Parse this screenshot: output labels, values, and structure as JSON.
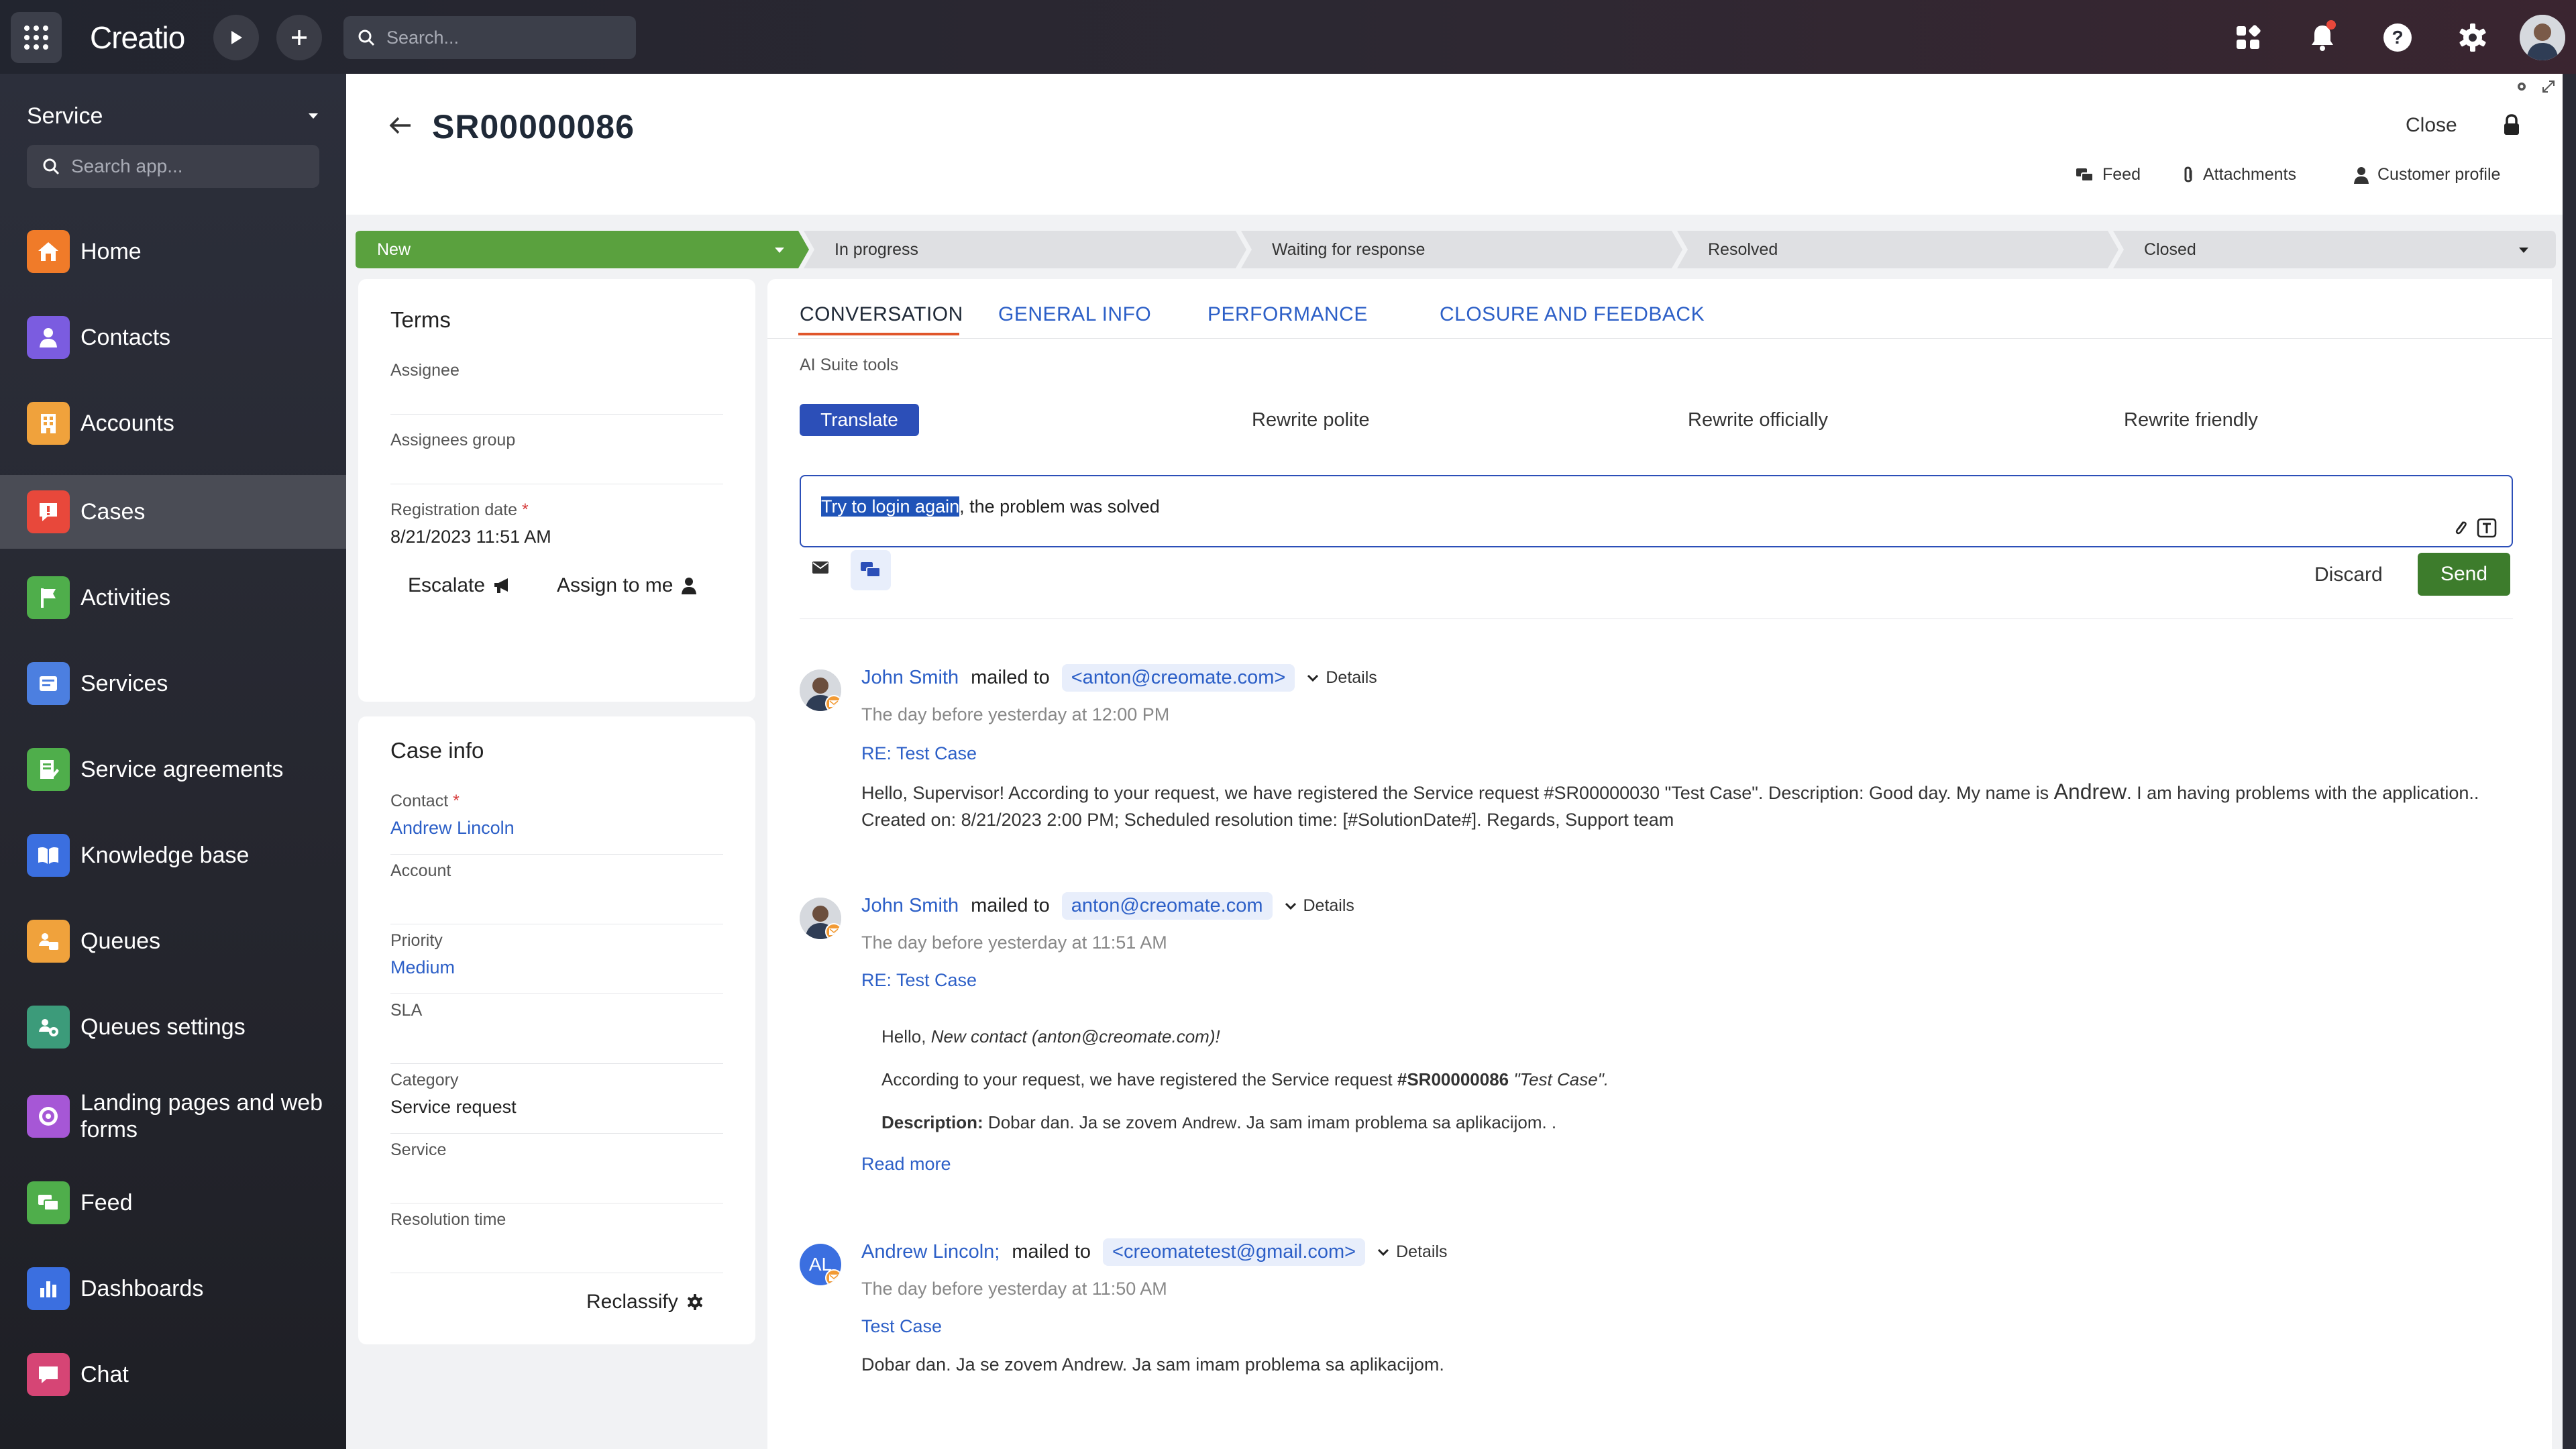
{
  "topbar": {
    "logo": "Creatio",
    "search_placeholder": "Search..."
  },
  "sidebar": {
    "workplace": "Service",
    "search_placeholder": "Search app...",
    "items": [
      {
        "label": "Home",
        "icon": "home-icon",
        "color": "#f07b29"
      },
      {
        "label": "Contacts",
        "icon": "contacts-icon",
        "color": "#7b5ce0"
      },
      {
        "label": "Accounts",
        "icon": "accounts-icon",
        "color": "#f0a23c"
      },
      {
        "label": "Cases",
        "icon": "cases-icon",
        "color": "#e8483b"
      },
      {
        "label": "Activities",
        "icon": "activities-icon",
        "color": "#4fae4b"
      },
      {
        "label": "Services",
        "icon": "services-icon",
        "color": "#4c7fe0"
      },
      {
        "label": "Service agreements",
        "icon": "service-agreements-icon",
        "color": "#4fae4b"
      },
      {
        "label": "Knowledge base",
        "icon": "knowledge-base-icon",
        "color": "#3b6fe0"
      },
      {
        "label": "Queues",
        "icon": "queues-icon",
        "color": "#f0a23c"
      },
      {
        "label": "Queues settings",
        "icon": "queues-settings-icon",
        "color": "#3c9b7a"
      },
      {
        "label": "Landing pages and web forms",
        "icon": "landing-pages-icon",
        "color": "#a657d6"
      },
      {
        "label": "Feed",
        "icon": "feed-icon",
        "color": "#4fae4b"
      },
      {
        "label": "Dashboards",
        "icon": "dashboards-icon",
        "color": "#3b6fe0"
      },
      {
        "label": "Chat",
        "icon": "chat-icon",
        "color": "#d64575"
      }
    ]
  },
  "record": {
    "title": "SR00000086",
    "close_label": "Close",
    "links": [
      "Feed",
      "Attachments",
      "Customer profile"
    ]
  },
  "stages": [
    "New",
    "In progress",
    "Waiting for response",
    "Resolved",
    "Closed"
  ],
  "terms": {
    "title": "Terms",
    "assignee_label": "Assignee",
    "assignees_group_label": "Assignees group",
    "registration_date_label": "Registration date",
    "registration_date": "8/21/2023 11:51 AM",
    "escalate": "Escalate",
    "assign_to_me": "Assign to me"
  },
  "case_info": {
    "title": "Case info",
    "contact_label": "Contact",
    "contact": "Andrew Lincoln",
    "account_label": "Account",
    "priority_label": "Priority",
    "priority": "Medium",
    "sla_label": "SLA",
    "category_label": "Category",
    "category": "Service request",
    "service_label": "Service",
    "resolution_time_label": "Resolution time",
    "reclassify": "Reclassify"
  },
  "tabs": [
    "CONVERSATION",
    "GENERAL INFO",
    "PERFORMANCE",
    "CLOSURE AND FEEDBACK"
  ],
  "ai": {
    "label": "AI Suite tools",
    "translate": "Translate",
    "rewrite_polite": "Rewrite polite",
    "rewrite_officially": "Rewrite officially",
    "rewrite_friendly": "Rewrite friendly"
  },
  "compose": {
    "highlighted": "Try to login again",
    "rest": ", the problem was solved",
    "discard": "Discard",
    "send": "Send"
  },
  "messages": [
    {
      "from": "John Smith",
      "mailed_to": "mailed to",
      "to": "<anton@creomate.com>",
      "details": "Details",
      "time": "The day before yesterday at 12:00 PM",
      "subject": "RE: Test Case",
      "body_1": "Hello, Supervisor! According to your request, we have registered the Service request #SR00000030 \"Test Case\". Description: Good day. My name is ",
      "body_name": "Andrew",
      "body_2": ". I am having problems with the application.. Created on: 8/21/2023 2:00 PM; Scheduled resolution time: [#SolutionDate#]. Regards, Support team"
    },
    {
      "from": "John Smith",
      "mailed_to": "mailed to",
      "to": "anton@creomate.com",
      "details": "Details",
      "time": "The day before yesterday at 11:51 AM",
      "subject": "RE: Test Case",
      "q1_a": "Hello, ",
      "q1_b": "New contact (anton@creomate.com)!",
      "q2_a": "According to your request, we have registered the Service request ",
      "q2_b": "#SR00000086",
      "q2_c": " \"Test Case\".",
      "q3_a": "Description:",
      "q3_b": " Dobar dan. Ja se zovem ",
      "q3_c": "Andrew",
      "q3_d": ". Ja sam imam problema sa aplikacijom. .",
      "read_more": "Read more"
    },
    {
      "from": "Andrew Lincoln;",
      "initials": "AL",
      "mailed_to": "mailed to",
      "to": "<creomatetest@gmail.com>",
      "details": "Details",
      "time": "The day before yesterday at 11:50 AM",
      "subject": "Test Case",
      "body": "Dobar dan. Ja se zovem Andrew. Ja sam imam problema sa aplikacijom."
    }
  ]
}
